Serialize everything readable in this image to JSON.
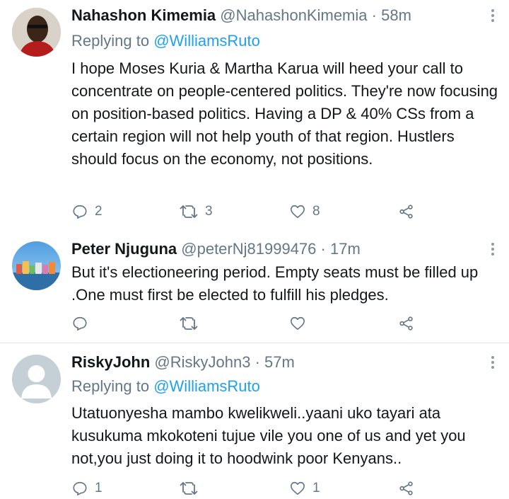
{
  "colors": {
    "link": "#1da1f2",
    "muted": "#657786",
    "text": "#14171a",
    "divider": "#e1e8ed"
  },
  "tweets": [
    {
      "name": "Nahashon Kimemia",
      "handle": "@NahashonKimemia",
      "separator": "·",
      "time": "58m",
      "replying_prefix": "Replying to",
      "replying_to": "@WilliamsRuto",
      "text": "I hope Moses Kuria & Martha Karua will heed your call to concentrate on people-centered politics. They're now focusing on position-based politics. Having a DP & 40% CSs from a certain region will not help youth of that region. Hustlers should focus on the economy, not positions.",
      "reply_count": "2",
      "retweet_count": "3",
      "like_count": "8"
    },
    {
      "name": "Peter Njuguna",
      "handle": "@peterNj81999476",
      "separator": "·",
      "time": "17m",
      "text": "But it's electioneering period. Empty seats must be filled up .One must first be elected to fulfill his pledges.",
      "reply_count": "",
      "retweet_count": "",
      "like_count": ""
    },
    {
      "name": "RiskyJohn",
      "handle": "@RiskyJohn3",
      "separator": "·",
      "time": "57m",
      "replying_prefix": "Replying to",
      "replying_to": "@WilliamsRuto",
      "text": "Utatuonyesha mambo kwelikweli..yaani uko tayari ata kusukuma mkokoteni tujue vile you one of us and yet you not,you just doing it to hoodwink poor Kenyans..",
      "reply_count": "1",
      "retweet_count": "",
      "like_count": "1"
    }
  ]
}
